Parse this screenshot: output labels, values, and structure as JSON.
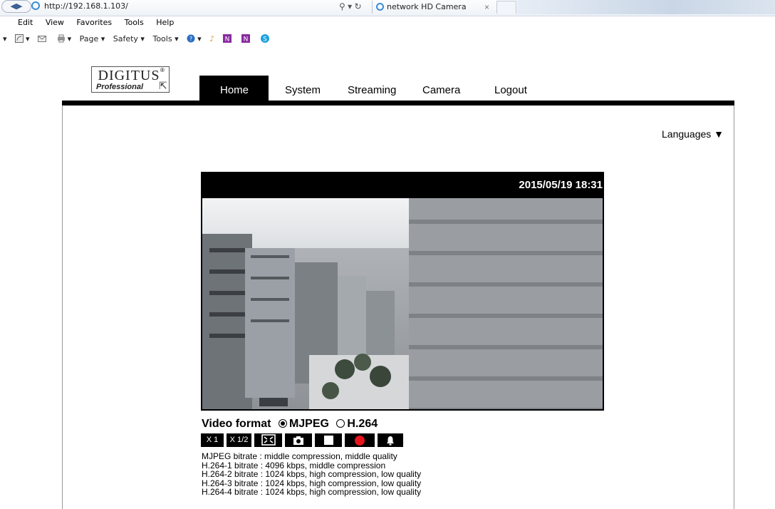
{
  "browser": {
    "address": "http://192.168.1.103/",
    "address_tools": "⚲ ▾ ↻",
    "tab_title": "network HD Camera",
    "tab_close": "×",
    "menu": [
      "Edit",
      "View",
      "Favorites",
      "Tools",
      "Help"
    ],
    "commands": [
      "Page ▾",
      "Safety ▾",
      "Tools ▾"
    ]
  },
  "logo": {
    "line1": "DIGITUS",
    "line2": "Professional",
    "registered": "®"
  },
  "nav": {
    "home": "Home",
    "system": "System",
    "streaming": "Streaming",
    "camera": "Camera",
    "logout": "Logout"
  },
  "languages": "Languages ▼",
  "video": {
    "timestamp": "2015/05/19 18:31"
  },
  "video_format": {
    "label": "Video format",
    "options": [
      "MJPEG",
      "H.264"
    ],
    "selected": "MJPEG"
  },
  "controls": {
    "x1": "X 1",
    "x12": "X 1/2"
  },
  "bitrates": [
    "MJPEG bitrate : middle compression, middle quality",
    "H.264-1 bitrate : 4096 kbps, middle compression",
    "H.264-2 bitrate : 1024 kbps, high compression, low quality",
    "H.264-3 bitrate : 1024 kbps, high compression, low quality",
    "H.264-4 bitrate : 1024 kbps, high compression, low quality"
  ]
}
